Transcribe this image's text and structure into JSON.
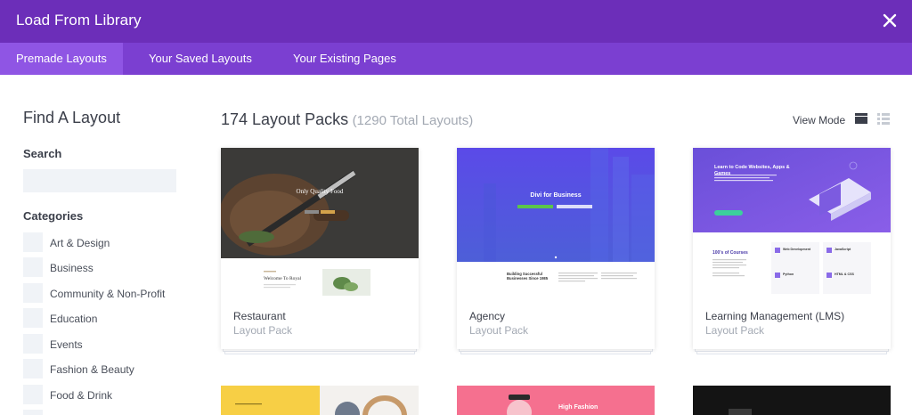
{
  "header": {
    "title": "Load From Library",
    "accent": "#6c2eb9"
  },
  "tabs": [
    {
      "label": "Premade Layouts",
      "active": true
    },
    {
      "label": "Your Saved Layouts",
      "active": false
    },
    {
      "label": "Your Existing Pages",
      "active": false
    }
  ],
  "sidebar": {
    "title": "Find A Layout",
    "search_label": "Search",
    "search_value": "",
    "categories_label": "Categories",
    "categories": [
      "Art & Design",
      "Business",
      "Community & Non-Profit",
      "Education",
      "Events",
      "Fashion & Beauty",
      "Food & Drink"
    ]
  },
  "main": {
    "count_text": "174 Layout Packs",
    "total_text": "(1290 Total Layouts)",
    "view_mode_label": "View Mode",
    "view_mode": "grid"
  },
  "cards": [
    {
      "name": "Restaurant",
      "sub": "Layout Pack",
      "thumb": {
        "hero_text": "Only Quality Food",
        "section_text": "Welcome To Royal"
      }
    },
    {
      "name": "Agency",
      "sub": "Layout Pack",
      "thumb": {
        "hero_text": "Divi for Business",
        "section_text": "Building Successful Businesses Since 1985"
      }
    },
    {
      "name": "Learning Management (LMS)",
      "sub": "Layout Pack",
      "thumb": {
        "hero_text": "Learn to Code Websites, Apps & Games",
        "section_text": "100's of Courses",
        "features": [
          "Web Development",
          "JavaScript",
          "Python",
          "HTML & CSS"
        ]
      }
    }
  ],
  "peek_cards": [
    {
      "hero_text": ""
    },
    {
      "hero_text": "High Fashion"
    },
    {
      "hero_text": ""
    }
  ]
}
